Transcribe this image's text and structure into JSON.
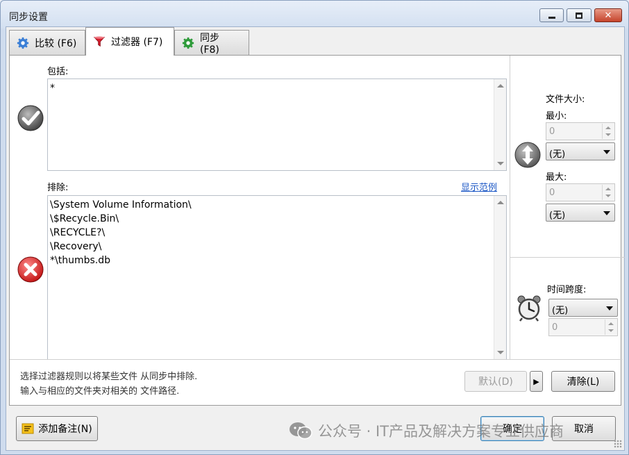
{
  "window": {
    "title": "同步设置"
  },
  "tabs": [
    {
      "label": "比较 (F6)",
      "icon": "gear-blue-icon",
      "active": false
    },
    {
      "label": "过滤器 (F7)",
      "icon": "funnel-icon",
      "active": true
    },
    {
      "label": "同步 (F8)",
      "icon": "gear-green-icon",
      "active": false
    }
  ],
  "filter": {
    "include_label": "包括:",
    "include_value": "*",
    "exclude_label": "排除:",
    "show_examples_link": "显示范例",
    "exclude_value": "\\System Volume Information\\\n\\$Recycle.Bin\\\n\\RECYCLE?\\\n\\Recovery\\\n*\\thumbs.db"
  },
  "file_size": {
    "title": "文件大小:",
    "min_label": "最小:",
    "min_value": "0",
    "min_unit": "(无)",
    "max_label": "最大:",
    "max_value": "0",
    "max_unit": "(无)"
  },
  "time_span": {
    "title": "时间跨度:",
    "unit": "(无)",
    "value": "0"
  },
  "hints": {
    "line1": "选择过滤器规则以将某些文件 从同步中排除.",
    "line2": "输入与相应的文件夹对相关的 文件路径."
  },
  "buttons": {
    "default": "默认(D)",
    "more": "▶",
    "clear": "清除(L)",
    "add_note": "添加备注(N)",
    "ok": "确定",
    "cancel": "取消"
  },
  "watermark": {
    "text": "公众号 · IT产品及解决方案专业供应商"
  },
  "colors": {
    "accent_link": "#1a56c5",
    "close_button": "#c6442c"
  }
}
